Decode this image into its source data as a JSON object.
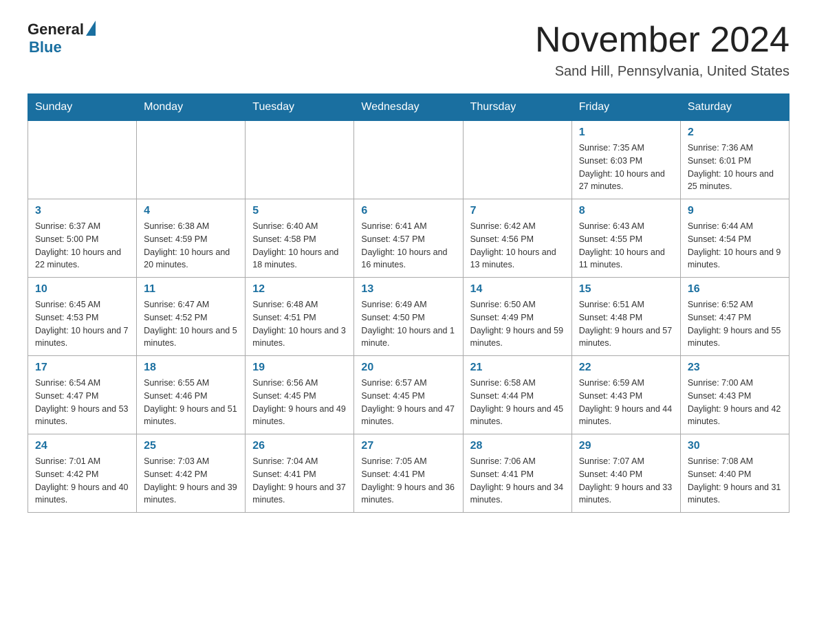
{
  "header": {
    "logo_general": "General",
    "logo_blue": "Blue",
    "month_title": "November 2024",
    "location": "Sand Hill, Pennsylvania, United States"
  },
  "days_of_week": [
    "Sunday",
    "Monday",
    "Tuesday",
    "Wednesday",
    "Thursday",
    "Friday",
    "Saturday"
  ],
  "weeks": [
    [
      {
        "day": "",
        "info": ""
      },
      {
        "day": "",
        "info": ""
      },
      {
        "day": "",
        "info": ""
      },
      {
        "day": "",
        "info": ""
      },
      {
        "day": "",
        "info": ""
      },
      {
        "day": "1",
        "info": "Sunrise: 7:35 AM\nSunset: 6:03 PM\nDaylight: 10 hours and 27 minutes."
      },
      {
        "day": "2",
        "info": "Sunrise: 7:36 AM\nSunset: 6:01 PM\nDaylight: 10 hours and 25 minutes."
      }
    ],
    [
      {
        "day": "3",
        "info": "Sunrise: 6:37 AM\nSunset: 5:00 PM\nDaylight: 10 hours and 22 minutes."
      },
      {
        "day": "4",
        "info": "Sunrise: 6:38 AM\nSunset: 4:59 PM\nDaylight: 10 hours and 20 minutes."
      },
      {
        "day": "5",
        "info": "Sunrise: 6:40 AM\nSunset: 4:58 PM\nDaylight: 10 hours and 18 minutes."
      },
      {
        "day": "6",
        "info": "Sunrise: 6:41 AM\nSunset: 4:57 PM\nDaylight: 10 hours and 16 minutes."
      },
      {
        "day": "7",
        "info": "Sunrise: 6:42 AM\nSunset: 4:56 PM\nDaylight: 10 hours and 13 minutes."
      },
      {
        "day": "8",
        "info": "Sunrise: 6:43 AM\nSunset: 4:55 PM\nDaylight: 10 hours and 11 minutes."
      },
      {
        "day": "9",
        "info": "Sunrise: 6:44 AM\nSunset: 4:54 PM\nDaylight: 10 hours and 9 minutes."
      }
    ],
    [
      {
        "day": "10",
        "info": "Sunrise: 6:45 AM\nSunset: 4:53 PM\nDaylight: 10 hours and 7 minutes."
      },
      {
        "day": "11",
        "info": "Sunrise: 6:47 AM\nSunset: 4:52 PM\nDaylight: 10 hours and 5 minutes."
      },
      {
        "day": "12",
        "info": "Sunrise: 6:48 AM\nSunset: 4:51 PM\nDaylight: 10 hours and 3 minutes."
      },
      {
        "day": "13",
        "info": "Sunrise: 6:49 AM\nSunset: 4:50 PM\nDaylight: 10 hours and 1 minute."
      },
      {
        "day": "14",
        "info": "Sunrise: 6:50 AM\nSunset: 4:49 PM\nDaylight: 9 hours and 59 minutes."
      },
      {
        "day": "15",
        "info": "Sunrise: 6:51 AM\nSunset: 4:48 PM\nDaylight: 9 hours and 57 minutes."
      },
      {
        "day": "16",
        "info": "Sunrise: 6:52 AM\nSunset: 4:47 PM\nDaylight: 9 hours and 55 minutes."
      }
    ],
    [
      {
        "day": "17",
        "info": "Sunrise: 6:54 AM\nSunset: 4:47 PM\nDaylight: 9 hours and 53 minutes."
      },
      {
        "day": "18",
        "info": "Sunrise: 6:55 AM\nSunset: 4:46 PM\nDaylight: 9 hours and 51 minutes."
      },
      {
        "day": "19",
        "info": "Sunrise: 6:56 AM\nSunset: 4:45 PM\nDaylight: 9 hours and 49 minutes."
      },
      {
        "day": "20",
        "info": "Sunrise: 6:57 AM\nSunset: 4:45 PM\nDaylight: 9 hours and 47 minutes."
      },
      {
        "day": "21",
        "info": "Sunrise: 6:58 AM\nSunset: 4:44 PM\nDaylight: 9 hours and 45 minutes."
      },
      {
        "day": "22",
        "info": "Sunrise: 6:59 AM\nSunset: 4:43 PM\nDaylight: 9 hours and 44 minutes."
      },
      {
        "day": "23",
        "info": "Sunrise: 7:00 AM\nSunset: 4:43 PM\nDaylight: 9 hours and 42 minutes."
      }
    ],
    [
      {
        "day": "24",
        "info": "Sunrise: 7:01 AM\nSunset: 4:42 PM\nDaylight: 9 hours and 40 minutes."
      },
      {
        "day": "25",
        "info": "Sunrise: 7:03 AM\nSunset: 4:42 PM\nDaylight: 9 hours and 39 minutes."
      },
      {
        "day": "26",
        "info": "Sunrise: 7:04 AM\nSunset: 4:41 PM\nDaylight: 9 hours and 37 minutes."
      },
      {
        "day": "27",
        "info": "Sunrise: 7:05 AM\nSunset: 4:41 PM\nDaylight: 9 hours and 36 minutes."
      },
      {
        "day": "28",
        "info": "Sunrise: 7:06 AM\nSunset: 4:41 PM\nDaylight: 9 hours and 34 minutes."
      },
      {
        "day": "29",
        "info": "Sunrise: 7:07 AM\nSunset: 4:40 PM\nDaylight: 9 hours and 33 minutes."
      },
      {
        "day": "30",
        "info": "Sunrise: 7:08 AM\nSunset: 4:40 PM\nDaylight: 9 hours and 31 minutes."
      }
    ]
  ]
}
